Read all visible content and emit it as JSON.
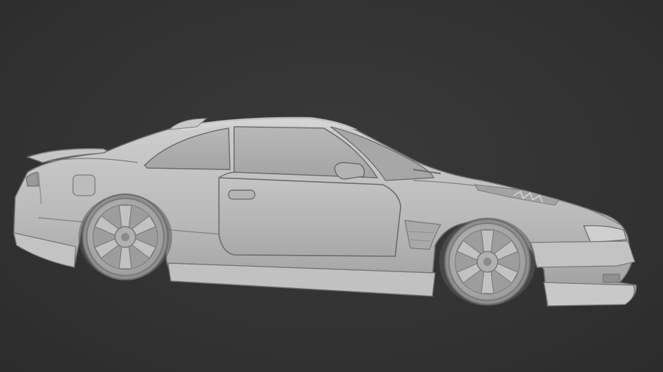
{
  "viewport": {
    "background": "#333333",
    "object": "car-model",
    "shading": "solid"
  },
  "model": {
    "body_color": "#bdbdbd",
    "shadow_color": "#8f8f8f",
    "line_color": "#6f6f6f",
    "glass_color": "#a8a8a8",
    "wheel_color": "#b5b5b5"
  }
}
